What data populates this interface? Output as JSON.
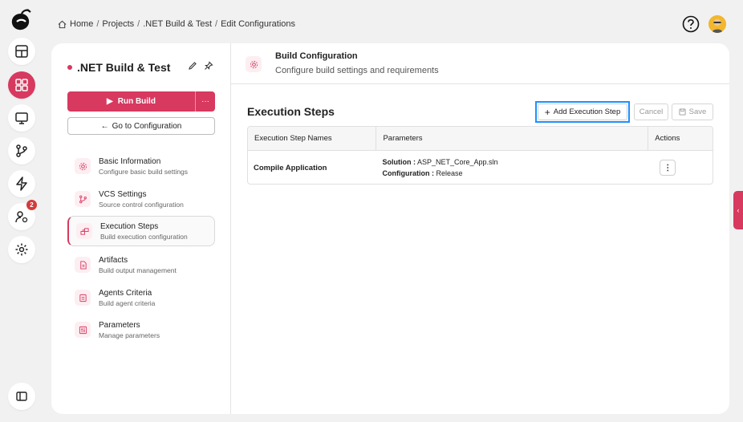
{
  "breadcrumb": {
    "home": "Home",
    "projects": "Projects",
    "project": ".NET Build & Test",
    "current": "Edit Configurations",
    "separator": "/"
  },
  "rail": {
    "badge_count": "2"
  },
  "project": {
    "title": ".NET Build & Test",
    "run_label": "Run Build",
    "more_label": "···",
    "goto_label": "Go to Configuration"
  },
  "nav": [
    {
      "title": "Basic Information",
      "subtitle": "Configure basic build settings"
    },
    {
      "title": "VCS Settings",
      "subtitle": "Source control configuration"
    },
    {
      "title": "Execution Steps",
      "subtitle": "Build execution configuration"
    },
    {
      "title": "Artifacts",
      "subtitle": "Build output management"
    },
    {
      "title": "Agents Criteria",
      "subtitle": "Build agent criteria"
    },
    {
      "title": "Parameters",
      "subtitle": "Manage parameters"
    }
  ],
  "header": {
    "title": "Build Configuration",
    "subtitle": "Configure build settings and requirements"
  },
  "steps": {
    "title": "Execution Steps",
    "add_label": "Add Execution Step",
    "cancel_label": "Cancel",
    "save_label": "Save",
    "columns": [
      "Execution Step Names",
      "Parameters",
      "Actions"
    ],
    "rows": [
      {
        "name": "Compile Application",
        "params": [
          {
            "key": "Solution :",
            "value": "ASP_NET_Core_App.sln"
          },
          {
            "key": "Configuration :",
            "value": "Release"
          }
        ],
        "action": "⋮"
      }
    ]
  },
  "colors": {
    "accent": "#d7395f",
    "focus": "#1e90ff"
  }
}
